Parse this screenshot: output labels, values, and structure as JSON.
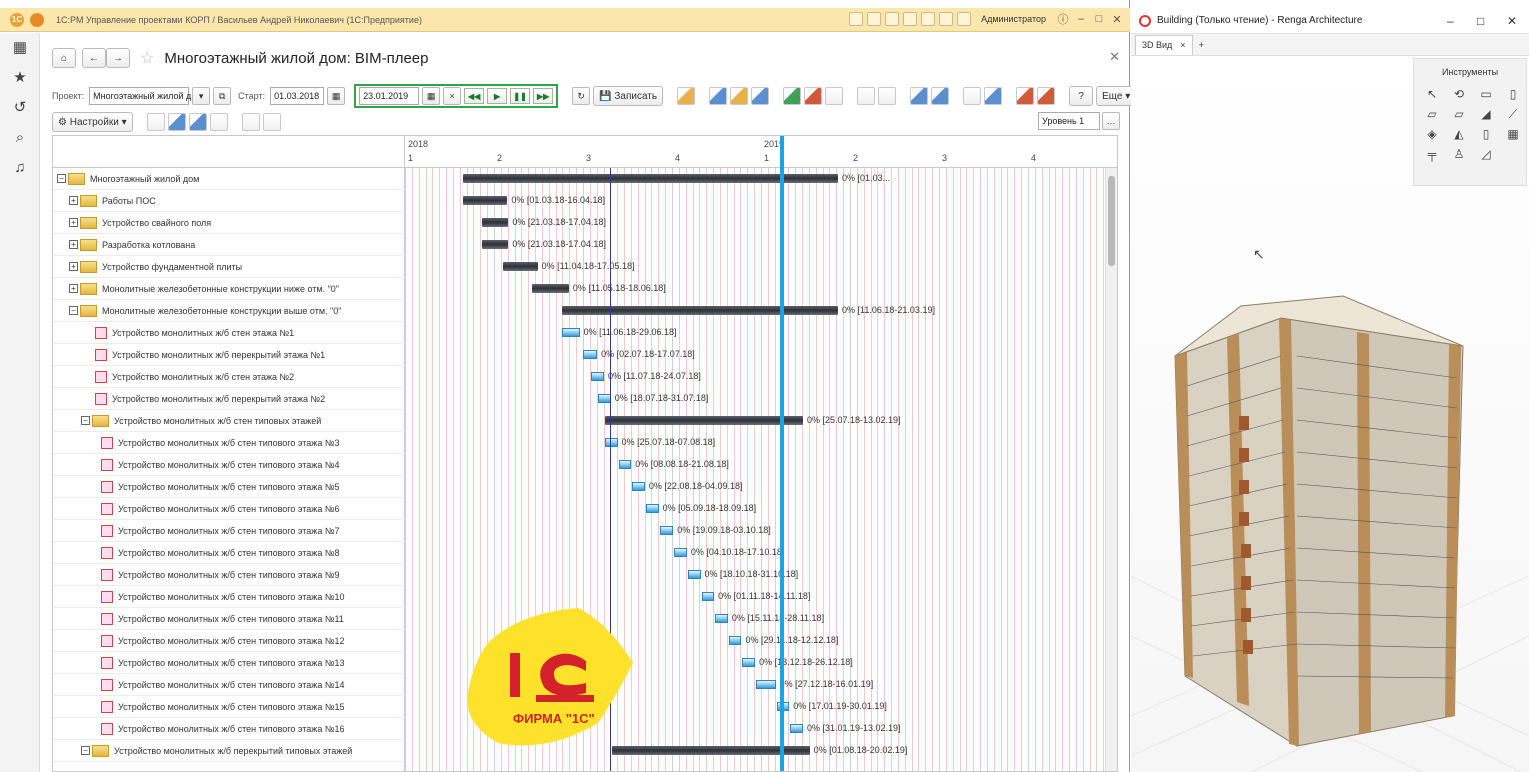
{
  "app1c": {
    "window_title": "1С:PM Управление проектами КОРП / Васильев Андрей Николаевич (1С:Предприятие)",
    "user": "Администратор",
    "page_title": "Многоэтажный жилой дом: BIM-плеер",
    "project_label": "Проект:",
    "project_value": "Многоэтажный жилой д|",
    "start_label": "Старт:",
    "start_value": "01.03.2018",
    "current_date": "23.01.2019",
    "save_label": "Записать",
    "help_label": "?",
    "more_label": "Еще",
    "settings_label": "Настройки",
    "level_label": "Уровень 1",
    "timeline": {
      "years": [
        "2018",
        "2019"
      ],
      "quarters": [
        "1",
        "2",
        "3",
        "4",
        "1",
        "2",
        "3",
        "4"
      ]
    },
    "rows": [
      {
        "name": "Многоэтажный жилой дом",
        "indent": 0,
        "kind": "folder",
        "toggle": "−",
        "label": "0% [01.03..."
      },
      {
        "name": "Работы ПОС",
        "indent": 1,
        "kind": "folder",
        "toggle": "+",
        "label": "0% [01.03.18-16.04.18]"
      },
      {
        "name": "Устройство свайного поля",
        "indent": 1,
        "kind": "folder",
        "toggle": "+",
        "label": "0% [21.03.18-17.04.18]"
      },
      {
        "name": "Разработка котлована",
        "indent": 1,
        "kind": "folder",
        "toggle": "+",
        "label": "0% [21.03.18-17.04.18]"
      },
      {
        "name": "Устройство фундаментной плиты",
        "indent": 1,
        "kind": "folder",
        "toggle": "+",
        "label": "0% [11.04.18-17.05.18]"
      },
      {
        "name": "Монолитные железобетонные конструкции ниже отм. \"0\"",
        "indent": 1,
        "kind": "folder",
        "toggle": "+",
        "label": "0% [11.05.18-18.06.18]"
      },
      {
        "name": "Монолитные железобетонные конструкции выше отм. \"0\"",
        "indent": 1,
        "kind": "folder",
        "toggle": "−",
        "label": "0% [11.06.18-21.03.19]"
      },
      {
        "name": "Устройство монолитных ж/б стен этажа №1",
        "indent": 2,
        "kind": "task",
        "toggle": "",
        "label": "0% [11.06.18-29.06.18]"
      },
      {
        "name": "Устройство монолитных ж/б перекрытий этажа №1",
        "indent": 2,
        "kind": "task",
        "toggle": "",
        "label": "0% [02.07.18-17.07.18]"
      },
      {
        "name": "Устройство монолитных ж/б стен этажа №2",
        "indent": 2,
        "kind": "task",
        "toggle": "",
        "label": "0% [11.07.18-24.07.18]"
      },
      {
        "name": "Устройство монолитных ж/б перекрытий этажа №2",
        "indent": 2,
        "kind": "task",
        "toggle": "",
        "label": "0% [18.07.18-31.07.18]"
      },
      {
        "name": "Устройство монолитных ж/б стен типовых этажей",
        "indent": 2,
        "kind": "folder",
        "toggle": "−",
        "label": "0% [25.07.18-13.02.19]"
      },
      {
        "name": "Устройство монолитных ж/б стен типового этажа №3",
        "indent": 3,
        "kind": "task",
        "toggle": "",
        "label": "0% [25.07.18-07.08.18]"
      },
      {
        "name": "Устройство монолитных ж/б стен типового этажа №4",
        "indent": 3,
        "kind": "task",
        "toggle": "",
        "label": "0% [08.08.18-21.08.18]"
      },
      {
        "name": "Устройство монолитных ж/б стен типового этажа №5",
        "indent": 3,
        "kind": "task",
        "toggle": "",
        "label": "0% [22.08.18-04.09.18]"
      },
      {
        "name": "Устройство монолитных ж/б стен типового этажа №6",
        "indent": 3,
        "kind": "task",
        "toggle": "",
        "label": "0% [05.09.18-18.09.18]"
      },
      {
        "name": "Устройство монолитных ж/б стен типового этажа №7",
        "indent": 3,
        "kind": "task",
        "toggle": "",
        "label": "0% [19.09.18-03.10.18]"
      },
      {
        "name": "Устройство монолитных ж/б стен типового этажа №8",
        "indent": 3,
        "kind": "task",
        "toggle": "",
        "label": "0% [04.10.18-17.10.18]"
      },
      {
        "name": "Устройство монолитных ж/б стен типового этажа №9",
        "indent": 3,
        "kind": "task",
        "toggle": "",
        "label": "0% [18.10.18-31.10.18]"
      },
      {
        "name": "Устройство монолитных ж/б стен типового этажа №10",
        "indent": 3,
        "kind": "task",
        "toggle": "",
        "label": "0% [01.11.18-14.11.18]"
      },
      {
        "name": "Устройство монолитных ж/б стен типового этажа №11",
        "indent": 3,
        "kind": "task",
        "toggle": "",
        "label": "0% [15.11.18-28.11.18]"
      },
      {
        "name": "Устройство монолитных ж/б стен типового этажа №12",
        "indent": 3,
        "kind": "task",
        "toggle": "",
        "label": "0% [29.11.18-12.12.18]"
      },
      {
        "name": "Устройство монолитных ж/б стен типового этажа №13",
        "indent": 3,
        "kind": "task",
        "toggle": "",
        "label": "0% [13.12.18-26.12.18]"
      },
      {
        "name": "Устройство монолитных ж/б стен типового этажа №14",
        "indent": 3,
        "kind": "task",
        "toggle": "",
        "label": "0% [27.12.18-16.01.19]"
      },
      {
        "name": "Устройство монолитных ж/б стен типового этажа №15",
        "indent": 3,
        "kind": "task",
        "toggle": "",
        "label": "0% [17.01.19-30.01.19]"
      },
      {
        "name": "Устройство монолитных ж/б стен типового этажа №16",
        "indent": 3,
        "kind": "task",
        "toggle": "",
        "label": "0% [31.01.19-13.02.19]"
      },
      {
        "name": "Устройство монолитных ж/б перекрытий типовых этажей",
        "indent": 2,
        "kind": "folder",
        "toggle": "−",
        "label": "0% [01.08.18-20.02.19]"
      }
    ],
    "bars": [
      {
        "start": "2018-03-01",
        "end": "2019-03-21",
        "style": "dark"
      },
      {
        "start": "2018-03-01",
        "end": "2018-04-16",
        "style": "dark"
      },
      {
        "start": "2018-03-21",
        "end": "2018-04-17",
        "style": "dark"
      },
      {
        "start": "2018-03-21",
        "end": "2018-04-17",
        "style": "dark"
      },
      {
        "start": "2018-04-11",
        "end": "2018-05-17",
        "style": "dark"
      },
      {
        "start": "2018-05-11",
        "end": "2018-06-18",
        "style": "dark"
      },
      {
        "start": "2018-06-11",
        "end": "2019-03-21",
        "style": "dark"
      },
      {
        "start": "2018-06-11",
        "end": "2018-06-29",
        "style": "task"
      },
      {
        "start": "2018-07-02",
        "end": "2018-07-17",
        "style": "task"
      },
      {
        "start": "2018-07-11",
        "end": "2018-07-24",
        "style": "task"
      },
      {
        "start": "2018-07-18",
        "end": "2018-07-31",
        "style": "task"
      },
      {
        "start": "2018-07-25",
        "end": "2019-02-13",
        "style": "dark"
      },
      {
        "start": "2018-07-25",
        "end": "2018-08-07",
        "style": "task"
      },
      {
        "start": "2018-08-08",
        "end": "2018-08-21",
        "style": "task"
      },
      {
        "start": "2018-08-22",
        "end": "2018-09-04",
        "style": "task"
      },
      {
        "start": "2018-09-05",
        "end": "2018-09-18",
        "style": "task"
      },
      {
        "start": "2018-09-19",
        "end": "2018-10-03",
        "style": "task"
      },
      {
        "start": "2018-10-04",
        "end": "2018-10-17",
        "style": "task"
      },
      {
        "start": "2018-10-18",
        "end": "2018-10-31",
        "style": "task"
      },
      {
        "start": "2018-11-01",
        "end": "2018-11-14",
        "style": "task"
      },
      {
        "start": "2018-11-15",
        "end": "2018-11-28",
        "style": "task"
      },
      {
        "start": "2018-11-29",
        "end": "2018-12-12",
        "style": "task"
      },
      {
        "start": "2018-12-13",
        "end": "2018-12-26",
        "style": "task"
      },
      {
        "start": "2018-12-27",
        "end": "2019-01-16",
        "style": "task"
      },
      {
        "start": "2019-01-17",
        "end": "2019-01-30",
        "style": "task"
      },
      {
        "start": "2019-01-31",
        "end": "2019-02-13",
        "style": "task"
      },
      {
        "start": "2018-08-01",
        "end": "2019-02-20",
        "style": "dark"
      }
    ],
    "current_marker_date": "2019-01-23",
    "logo_text": "ФИРМА \"1С\"",
    "colors": {
      "current_line": "#1aa5e0",
      "titlebar": "#fbe7ac",
      "player_frame": "#2fa54a"
    }
  },
  "renga": {
    "window_title": "Building (Только чтение) - Renga Architecture",
    "tab_label": "3D Вид",
    "tools_title": "Инструменты"
  }
}
